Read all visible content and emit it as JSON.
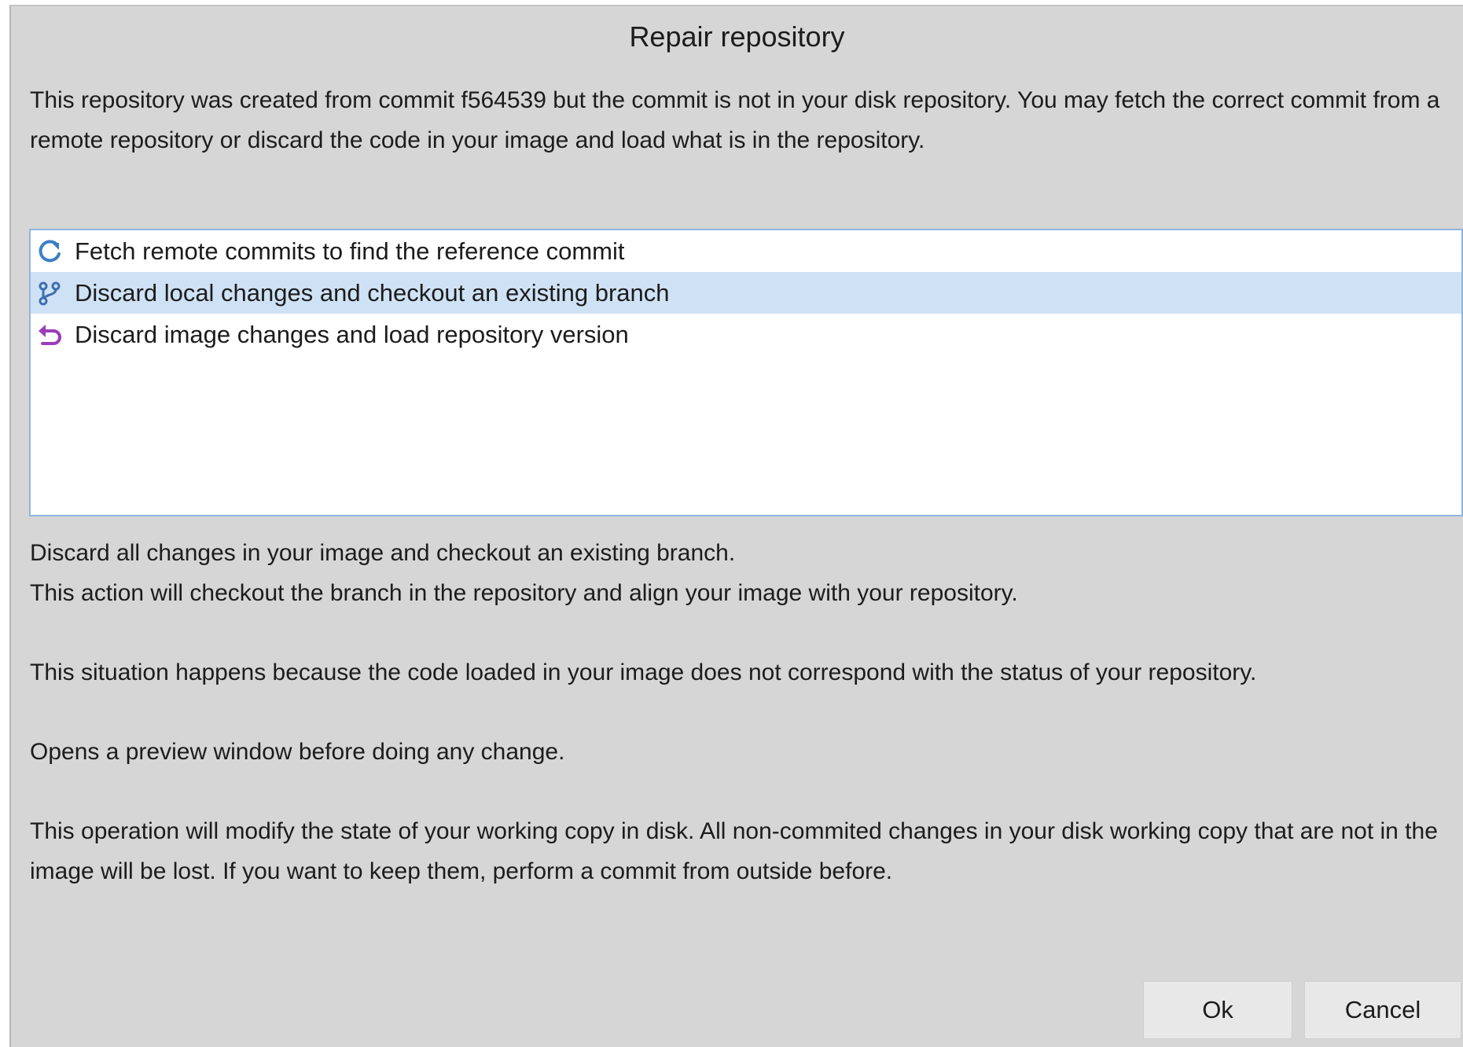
{
  "dialog": {
    "title": "Repair repository",
    "intro": "This repository was created from commit f564539 but the commit is not in your disk repository. You may fetch the correct commit from a remote repository or discard the code in your image and load what is in the repository.",
    "options": [
      {
        "label": "Fetch remote commits to find the reference commit",
        "icon": "refresh-icon",
        "selected": false
      },
      {
        "label": "Discard local changes and checkout an existing branch",
        "icon": "branch-icon",
        "selected": true
      },
      {
        "label": "Discard image changes and load repository version",
        "icon": "undo-arrow-icon",
        "selected": false
      }
    ],
    "description": {
      "line1": "Discard all changes in your image and checkout an existing branch.",
      "line2": "This action will checkout the branch in the repository and align your image with your repository.",
      "line3": "This situation happens because the code loaded in your image does not correspond with the status of your repository.",
      "line4": "Opens a preview window before doing any change.",
      "line5": "This operation will modify the state of your working copy in disk. All non-commited changes in your disk working copy that are not in the image will be lost. If you want to keep them, perform a commit from outside before."
    },
    "buttons": {
      "ok": "Ok",
      "cancel": "Cancel"
    }
  },
  "colors": {
    "window_bg": "#d6d6d6",
    "list_border": "#8fb6dc",
    "selection_bg": "#cfe2f5",
    "refresh_icon": "#3b7fc4",
    "branch_icon": "#3d6fb0",
    "undo_icon": "#9b3db8"
  }
}
